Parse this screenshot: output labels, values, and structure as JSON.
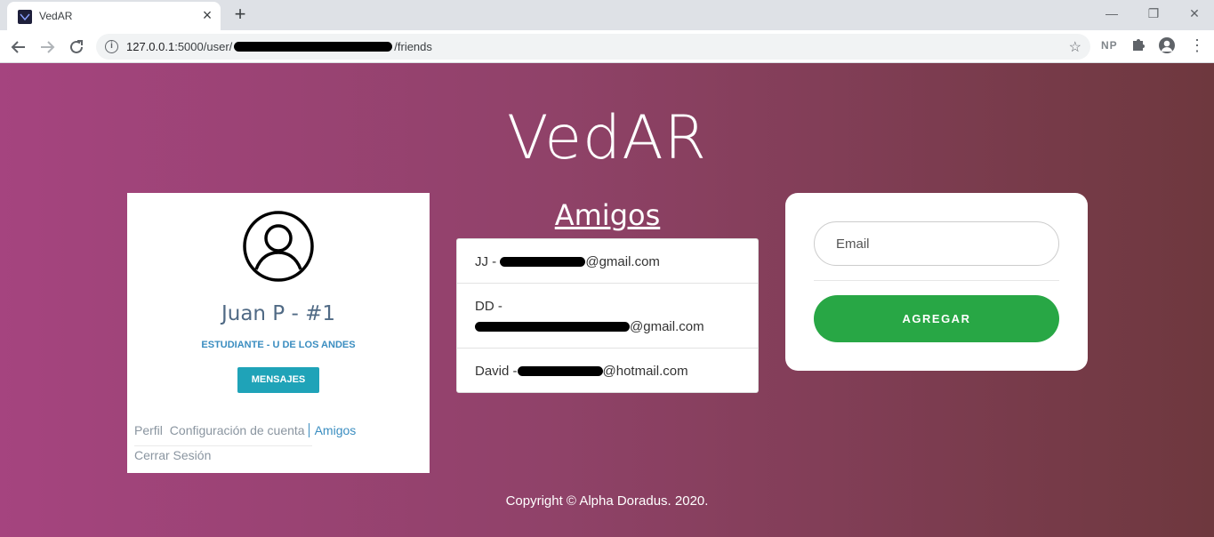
{
  "browser": {
    "tab_title": "VedAR",
    "tab_close": "×",
    "new_tab": "+",
    "url_host": "127.0.0.1",
    "url_before": ":5000/user/",
    "url_after": "/friends",
    "extension_label": "NP",
    "window_controls": {
      "minimize": "—",
      "restore": "❐",
      "close": "✕"
    }
  },
  "brand": {
    "title": "VedAR"
  },
  "profile": {
    "name": "Juan P - #1",
    "role": "ESTUDIANTE - U DE LOS ANDES",
    "messages_button": "MENSAJES",
    "nav": {
      "profile": "Perfil",
      "settings": "Configuración de cuenta",
      "friends": "Amigos",
      "logout": "Cerrar Sesión"
    }
  },
  "friends": {
    "title": "Amigos",
    "items": [
      {
        "prefix": "JJ - ",
        "domain": "@gmail.com"
      },
      {
        "prefix": "DD - ",
        "domain": "@gmail.com"
      },
      {
        "prefix": "David -",
        "domain": "@hotmail.com"
      }
    ]
  },
  "add_friend": {
    "email_placeholder": "Email",
    "button_label": "AGREGAR"
  },
  "footer": {
    "copyright": "Copyright © Alpha Doradus. 2020."
  },
  "colors": {
    "gradient_start": "#a5447f",
    "gradient_end": "#6e383e",
    "messages_button": "#1fa3b8",
    "add_button": "#28a745",
    "name_text": "#506a85",
    "link_blue": "#3a8dc0"
  }
}
